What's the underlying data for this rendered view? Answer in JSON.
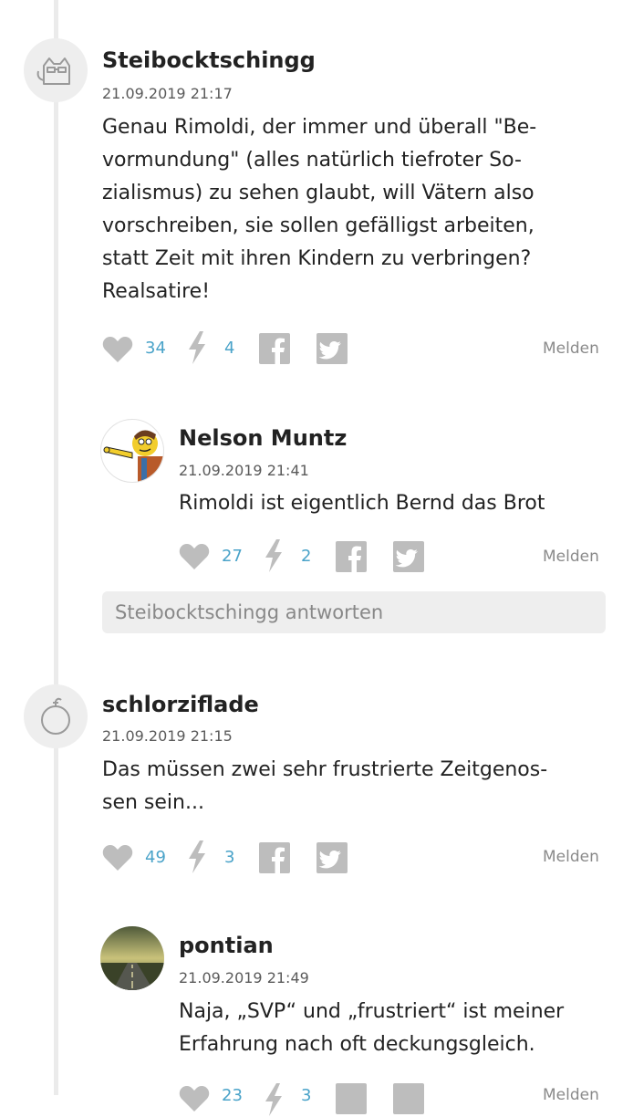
{
  "colors": {
    "accent": "#4aa3c9",
    "icon_gray": "#bdbdbd",
    "thread_line": "#ebebeb"
  },
  "comments": [
    {
      "author": "Steibocktschingg",
      "avatar_icon": "cat-avatar-icon",
      "date": "21.09.2019 21:17",
      "lines": [
        "Genau Rimoldi, der immer und überall \"Be-",
        "vormundung\" (alles natürlich tiefroter So-",
        "zialismus) zu sehen glaubt, will Vätern also",
        "vorschreiben, sie sollen gefälligst arbeiten,",
        "statt Zeit mit ihren Kindern zu verbringen?",
        "Realsatire!"
      ],
      "likes": "34",
      "flashes": "4",
      "report_label": "Melden"
    },
    {
      "author": "Nelson Muntz",
      "avatar_icon": "nelson-avatar-icon",
      "date": "21.09.2019 21:41",
      "lines": [
        "Rimoldi ist eigentlich Bernd das Brot"
      ],
      "likes": "27",
      "flashes": "2",
      "report_label": "Melden"
    },
    {
      "author": "schlorziflade",
      "avatar_icon": "bomb-avatar-icon",
      "date": "21.09.2019 21:15",
      "lines": [
        "Das müssen zwei sehr frustrierte Zeitgenos-",
        "sen sein..."
      ],
      "likes": "49",
      "flashes": "3",
      "report_label": "Melden"
    },
    {
      "author": "pontian",
      "avatar_icon": "road-avatar-icon",
      "date": "21.09.2019 21:49",
      "lines": [
        "Naja, „SVP“ und „frustriert“ ist meiner",
        "Erfahrung nach oft deckungsgleich."
      ],
      "likes": "23",
      "flashes": "3",
      "report_label": "Melden"
    }
  ],
  "reply_box": {
    "placeholder": "Steibocktschingg antworten"
  }
}
